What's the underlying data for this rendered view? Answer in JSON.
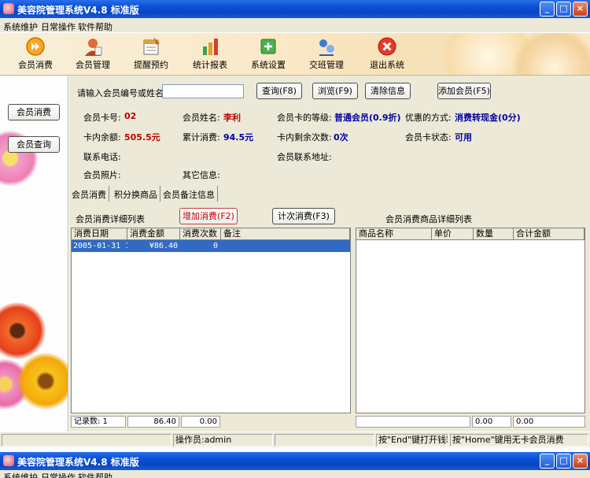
{
  "window": {
    "title": "美容院管理系统V4.8 标准版",
    "minimize": "_",
    "maximize": "□",
    "close": "×"
  },
  "menu": [
    "系统维护",
    "日常操作",
    "软件帮助"
  ],
  "toolbar": [
    {
      "label": "会员消费",
      "icon": "play-circle-icon"
    },
    {
      "label": "会员管理",
      "icon": "member-icon"
    },
    {
      "label": "提醒预约",
      "icon": "calendar-icon"
    },
    {
      "label": "统计报表",
      "icon": "chart-icon"
    },
    {
      "label": "系统设置",
      "icon": "settings-icon"
    },
    {
      "label": "交班管理",
      "icon": "shift-icon"
    },
    {
      "label": "退出系统",
      "icon": "exit-icon"
    }
  ],
  "sidebar": {
    "buttons": [
      "会员消费",
      "会员查询"
    ]
  },
  "search": {
    "label": "请输入会员编号或姓名",
    "value": "",
    "query_button": "查询(F8)",
    "browse_button": "浏览(F9)",
    "clear_button": "清除信息",
    "add_member_button": "添加会员(F5)"
  },
  "member": {
    "card_no_label": "会员卡号:",
    "card_no": "02",
    "name_label": "会员姓名:",
    "name": "李利",
    "level_label": "会员卡的等级:",
    "level": "普通会员(0.9折)",
    "discount_label": "优惠的方式:",
    "discount": "消费转现金(0分)",
    "balance_label": "卡内余额:",
    "balance": "505.5元",
    "total_label": "累计消费:",
    "total": "94.5元",
    "remaining_label": "卡内剩余次数:",
    "remaining": "0次",
    "status_label": "会员卡状态:",
    "status": "可用",
    "phone_label": "联系电话:",
    "address_label": "会员联系地址:",
    "photo_label": "会员照片:",
    "other_label": "其它信息:"
  },
  "tabs": [
    "会员消费",
    "积分换商品",
    "会员备注信息"
  ],
  "consume": {
    "list_title": "会员消费详细列表",
    "add_button": "增加消费(F2)",
    "count_button": "计次消费(F3)",
    "product_title": "会员消费商品详细列表",
    "columns": [
      "消费日期",
      "消费金额",
      "消费次数",
      "备注"
    ],
    "rows": [
      {
        "date": "2005-01-31 11",
        "amount": "¥86.40",
        "count": "0",
        "note": ""
      }
    ],
    "footer": {
      "records": "记录数: 1",
      "amount": "86.40",
      "count": "0.00"
    }
  },
  "products": {
    "columns": [
      "商品名称",
      "单价",
      "数量",
      "合计金额"
    ],
    "footer": {
      "qty": "0.00",
      "total": "0.00"
    }
  },
  "statusbar": {
    "operator": "操作员:admin",
    "end_hint": "按\"End\"键打开钱箱",
    "home_hint": "按\"Home\"键用无卡会员消费"
  },
  "second_window": {
    "title": "美容院管理系统V4.8 标准版",
    "menu": [
      "系统维护",
      "日常操作",
      "软件帮助"
    ]
  },
  "colors": {
    "titlebar": "#0b52d8",
    "selection": "#316ac5",
    "value_red": "#c00000",
    "value_blue": "#0000a0"
  }
}
